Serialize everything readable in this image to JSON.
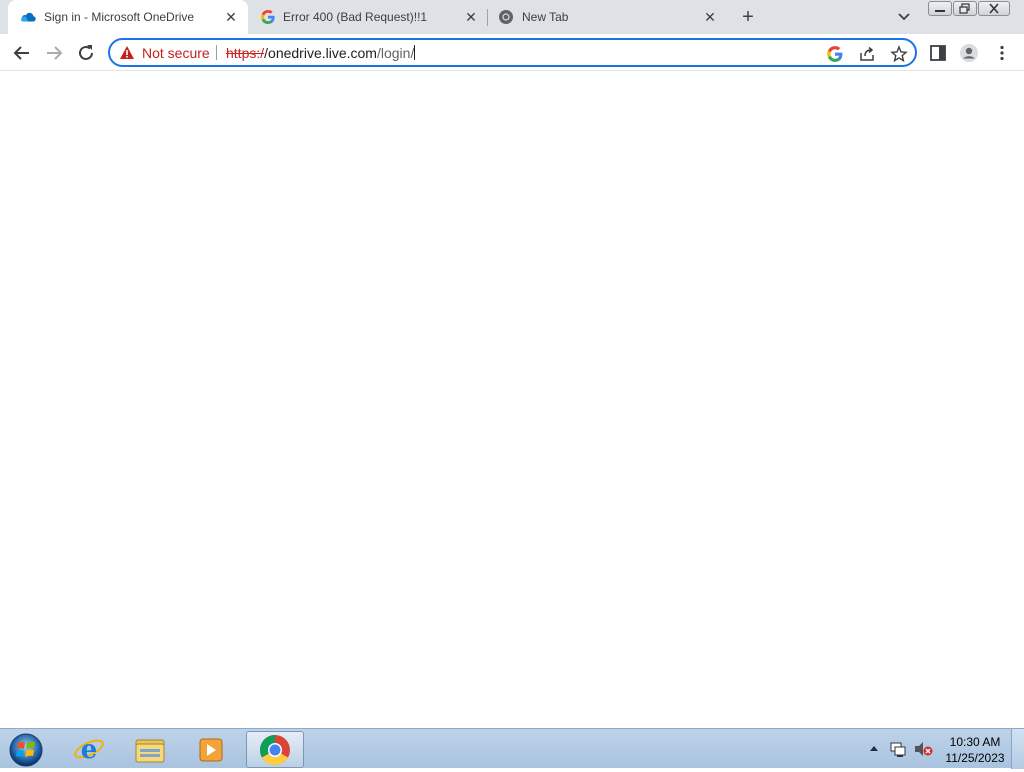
{
  "tabs": [
    {
      "title": "Sign in - Microsoft OneDrive",
      "icon": "onedrive-cloud-icon",
      "active": true
    },
    {
      "title": "Error 400 (Bad Request)!!1",
      "icon": "google-g-icon",
      "active": false
    },
    {
      "title": "New Tab",
      "icon": "chrome-icon",
      "active": false
    }
  ],
  "new_tab_label": "+",
  "close_glyph": "✕",
  "omnibox": {
    "security_label": "Not secure",
    "url_scheme": "https:/",
    "url_host": "/onedrive.live.com",
    "url_path": "/login/"
  },
  "taskbar": {
    "apps": [
      "internet-explorer-icon",
      "file-explorer-icon",
      "media-player-icon",
      "chrome-icon"
    ],
    "active_app": "chrome-icon",
    "time": "10:30 AM",
    "date": "11/25/2023"
  },
  "colors": {
    "accent": "#1a73e8",
    "warning": "#c5221f",
    "tabstrip": "#dee1e6",
    "taskbar": "#b3cbe5"
  }
}
